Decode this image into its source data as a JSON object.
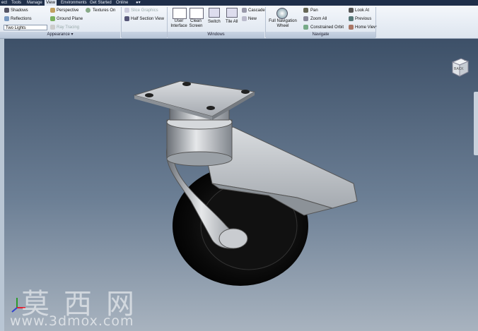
{
  "tabs": [
    {
      "label": "ect"
    },
    {
      "label": "Tools"
    },
    {
      "label": "Manage"
    },
    {
      "label": "View",
      "active": true
    },
    {
      "label": "Environments"
    },
    {
      "label": "Get Started"
    },
    {
      "label": "Online"
    }
  ],
  "appearance": {
    "shadows": "Shadows",
    "reflections": "Reflections",
    "lighting": "Two Lights",
    "perspective": "Perspective",
    "ground_plane": "Ground Plane",
    "ray_tracing": "Ray Tracing",
    "textures": "Textures On",
    "group_label": "Appearance"
  },
  "visibility": {
    "slice_graphics": "Slice Graphics",
    "half_section": "Half Section View"
  },
  "windows": {
    "user_interface": "User Interface",
    "clean_screen": "Clean Screen",
    "switch": "Switch",
    "tile_all": "Tile All",
    "cascade": "Cascade",
    "new": "New",
    "group_label": "Windows"
  },
  "navigate": {
    "full_nav_wheel": "Full Navigation Wheel",
    "pan": "Pan",
    "zoom_all": "Zoom All",
    "constrained_orbit": "Constrained Orbit",
    "look_at": "Look At",
    "previous": "Previous",
    "home_view": "Home View",
    "group_label": "Navigate"
  },
  "viewcube_face": "BACK",
  "watermark": {
    "cn": "莫西网",
    "url": "www.3dmox.com"
  },
  "colors": {
    "tabbar": "#1f2f4a",
    "ribbon": "#e8eef5",
    "viewport_top": "#3d5068",
    "viewport_bottom": "#a8b3bf"
  }
}
